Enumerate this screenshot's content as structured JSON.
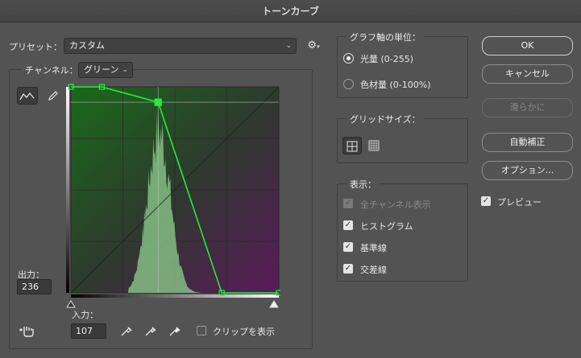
{
  "window": {
    "title": "トーンカーブ"
  },
  "preset": {
    "label": "プリセット：",
    "value": "カスタム"
  },
  "channel": {
    "label": "チャンネル：",
    "value": "グリーン"
  },
  "output": {
    "label": "出力：",
    "value": "236"
  },
  "input": {
    "label": "入力：",
    "value": "107"
  },
  "clip": {
    "label": "クリップを表示",
    "checked": false
  },
  "graph_unit": {
    "title": "グラフ軸の単位：",
    "options": [
      {
        "label": "光量 (0-255)",
        "selected": true
      },
      {
        "label": "色材量 (0-100%)",
        "selected": false
      }
    ]
  },
  "grid_size": {
    "title": "グリッドサイズ：",
    "selected": "simple"
  },
  "display": {
    "title": "表示：",
    "options": [
      {
        "label": "全チャンネル表示",
        "checked": true,
        "disabled": true
      },
      {
        "label": "ヒストグラム",
        "checked": true,
        "disabled": false
      },
      {
        "label": "基準線",
        "checked": true,
        "disabled": false
      },
      {
        "label": "交差線",
        "checked": true,
        "disabled": false
      }
    ]
  },
  "buttons": {
    "ok": "OK",
    "cancel": "キャンセル",
    "smooth": "滑らかに",
    "auto": "自動補正",
    "options": "オプション..."
  },
  "preview": {
    "label": "プレビュー",
    "checked": true
  },
  "curve": {
    "points": [
      [
        0,
        255
      ],
      [
        38,
        255
      ],
      [
        107,
        236
      ],
      [
        185,
        0
      ],
      [
        255,
        0
      ]
    ],
    "selected_point": [
      107,
      236
    ]
  },
  "colors": {
    "curve": "#22ee3a",
    "histogram": "#8fd08f",
    "accent_green": "#1a6a1a",
    "accent_purple": "#5a1a5a"
  }
}
